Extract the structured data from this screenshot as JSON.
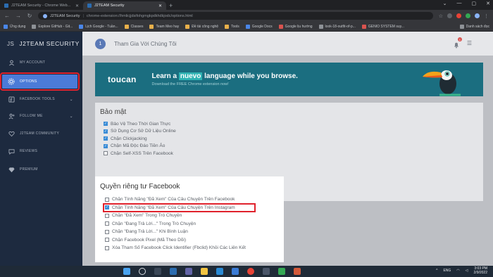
{
  "browser": {
    "tabs": [
      {
        "label": "J2TEAM Security - Chrome Web..."
      },
      {
        "label": "J2TEAM Security"
      }
    ],
    "new_tab": "+",
    "window_controls": [
      "⌄",
      "—",
      "▢",
      "✕"
    ],
    "address": {
      "site": "J2TEAM Security",
      "url": "chrome-extension://hmlicjjdsifohgmgkpdkhdkjodc/options.html"
    },
    "bookmarks": [
      "Ứng dụng",
      "Explore GitHub - Git...",
      "Lịch Google - Tuần...",
      "Classes",
      "Team Meo hay",
      "Đề tài công nghệ",
      "Tools",
      "Google Docs",
      "Google lịu hướng",
      "look-18-outfit-of-p...",
      "GENIO SYSTEM suy...",
      "Danh sách đọc"
    ]
  },
  "sidebar": {
    "brand_prefix": "JS",
    "brand": "J2TEAM SECURITY",
    "items": [
      {
        "label": "MY ACCOUNT",
        "icon": "user-icon"
      },
      {
        "label": "OPTIONS",
        "icon": "gear-icon"
      },
      {
        "label": "FACEBOOK TOOLS",
        "icon": "facebook-icon"
      },
      {
        "label": "FOLLOW ME",
        "icon": "user-plus-icon"
      },
      {
        "label": "J2TEAM COMMUNITY",
        "icon": "heart-icon"
      },
      {
        "label": "REVIEWS",
        "icon": "chat-icon"
      },
      {
        "label": "PREMIUM",
        "icon": "diamond-icon"
      }
    ]
  },
  "topbar": {
    "step": "1",
    "join_text": "Tham Gia Với Chúng Tôi",
    "notif_count": "1"
  },
  "banner": {
    "logo": "toucan",
    "line1_pre": "Learn a ",
    "line1_hl": "nuevo",
    "line1_post": " language while you browse.",
    "line2": "Download the FREE Chrome extension now!"
  },
  "security": {
    "title": "Bảo mật",
    "options": [
      {
        "label": "Bảo Vệ Theo Thời Gian Thực",
        "checked": true
      },
      {
        "label": "Sử Dụng Cơ Sở Dữ Liệu Online",
        "checked": true
      },
      {
        "label": "Chặn Clickjacking",
        "checked": true
      },
      {
        "label": "Chặn Mã Độc Đáo Tiền Ảo",
        "checked": true
      },
      {
        "label": "Chặn Self-XSS Trên Facebook",
        "checked": false
      }
    ]
  },
  "privacy": {
    "title": "Quyền riêng tư Facebook",
    "options": [
      {
        "label": "Chặn Tính Năng \"Đã Xem\" Của Câu Chuyện Trên Facebook",
        "checked": false
      },
      {
        "label": "Chặn Tính Năng \"Đã Xem\" Của Câu Chuyện Trên Instagram",
        "checked": true
      },
      {
        "label": "Chặn \"Đã Xem\" Trong Trò Chuyện",
        "checked": false
      },
      {
        "label": "Chặn \"Đang Trả Lời...\" Trong Trò Chuyện",
        "checked": false
      },
      {
        "label": "Chặn \"Đang Trả Lời...\" Khi Bình Luận",
        "checked": false
      },
      {
        "label": "Chặn Facebook Pixel (Mã Theo Dõi)",
        "checked": false
      },
      {
        "label": "Xóa Tham Số Facebook Click Identifier (Fbclid) Khỏi Các Liên Kết",
        "checked": false
      }
    ]
  },
  "taskbar": {
    "time": "3:03 PM",
    "date": "2/9/2022",
    "lang": "ENG",
    "colors": {
      "win": "#4aa3f0",
      "chrome": "#e94235"
    }
  }
}
